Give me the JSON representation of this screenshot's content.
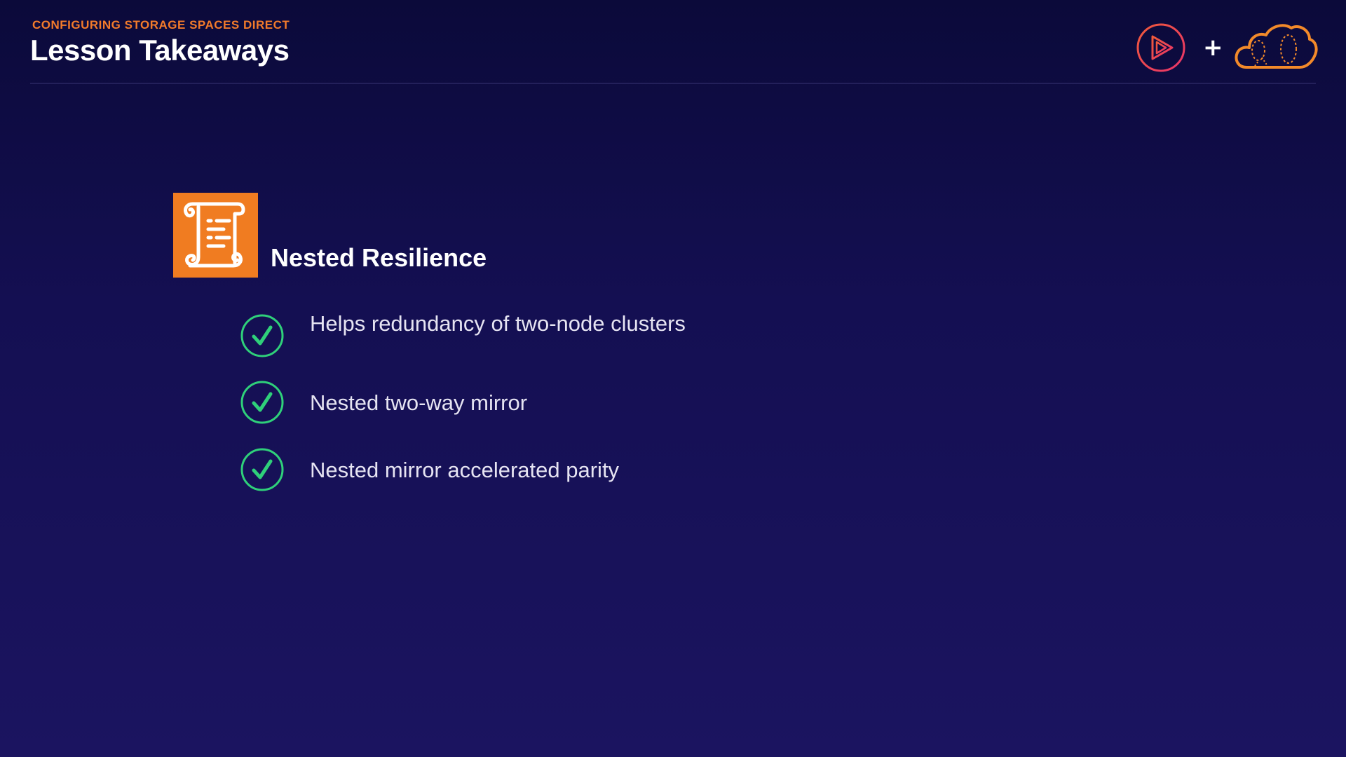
{
  "header": {
    "course_label": "CONFIGURING STORAGE SPACES DIRECT",
    "lesson_title": "Lesson Takeaways"
  },
  "brand": {
    "play_logo_icon": "play-logo-icon",
    "plus_label": "+",
    "cloud_logo_icon": "cloud-logo-icon",
    "colors": {
      "play_logo": "#e8336b",
      "cloud_logo": "#f38a2a"
    }
  },
  "section": {
    "icon": "scroll-icon",
    "icon_bg": "#f07c21",
    "title": "Nested Resilience"
  },
  "bullets": [
    {
      "icon": "check-circle-icon",
      "text": "Helps redundancy of two-node clusters"
    },
    {
      "icon": "check-circle-icon",
      "text": "Nested two-way mirror"
    },
    {
      "icon": "check-circle-icon",
      "text": "Nested mirror accelerated parity"
    }
  ],
  "colors": {
    "accent_orange": "#f37b2b",
    "check_green": "#2fd07a",
    "background_top": "#0b0a3a",
    "background_bottom": "#1b1460"
  }
}
